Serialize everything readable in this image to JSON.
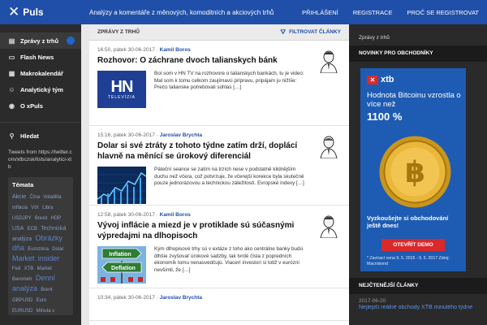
{
  "header": {
    "logo_text": "Puls",
    "tagline": "Analýzy a komentáře z měnových, komoditních a akciových trhů",
    "nav": [
      "PŘIHLÁŠENÍ",
      "REGISTRACE",
      "PROČ SE REGISTROVAT"
    ]
  },
  "sidebar": {
    "items": [
      {
        "label": "Zprávy z trhů",
        "icon": "feed-icon"
      },
      {
        "label": "Flash News",
        "icon": "flash-icon"
      },
      {
        "label": "Makrokalendář",
        "icon": "calendar-icon"
      },
      {
        "label": "Analytický tým",
        "icon": "person-icon"
      },
      {
        "label": "O xPuls",
        "icon": "info-icon"
      }
    ],
    "search_label": "Hledat",
    "tweets_text": "Tweets from https://twitter.com/xtbczsk/lists/analytici-xtb",
    "topics_title": "Témata",
    "topics": [
      {
        "t": "Akcie",
        "s": 2
      },
      {
        "t": "Čína",
        "s": 1
      },
      {
        "t": "Volatilita",
        "s": 1
      },
      {
        "t": "Inflácia",
        "s": 1
      },
      {
        "t": "VIX",
        "s": 1
      },
      {
        "t": "Libra",
        "s": 1
      },
      {
        "t": "USDJPY",
        "s": 1
      },
      {
        "t": "Brexit",
        "s": 1
      },
      {
        "t": "HDP",
        "s": 1
      },
      {
        "t": "USA",
        "s": 2
      },
      {
        "t": "ECB",
        "s": 1
      },
      {
        "t": "Technická",
        "s": 2
      },
      {
        "t": "analýza",
        "s": 2
      },
      {
        "t": "Obrázky",
        "s": 3
      },
      {
        "t": "dňa",
        "s": 3
      },
      {
        "t": "Eurozóna",
        "s": 1
      },
      {
        "t": "Dolar",
        "s": 1
      },
      {
        "t": "Market",
        "s": 3
      },
      {
        "t": "insider",
        "s": 3
      },
      {
        "t": "Fed",
        "s": 1
      },
      {
        "t": "XTB",
        "s": 1
      },
      {
        "t": "Market",
        "s": 1
      },
      {
        "t": "Barometr",
        "s": 1
      },
      {
        "t": "Denní",
        "s": 3
      },
      {
        "t": "analýza",
        "s": 3
      },
      {
        "t": "Brent",
        "s": 1
      },
      {
        "t": "GBPUSD",
        "s": 1
      },
      {
        "t": "Euro",
        "s": 1
      },
      {
        "t": "EURUSD",
        "s": 1
      },
      {
        "t": "Minuta s",
        "s": 1
      },
      {
        "t": "XTB",
        "s": 2
      },
      {
        "t": "Ranní",
        "s": 3
      },
      {
        "t": "komentář",
        "s": 3
      },
      {
        "t": "Měnová",
        "s": 1
      }
    ]
  },
  "main": {
    "section_title": "ZPRÁVY Z TRHŮ",
    "filter_label": "FILTROVAT ČLÁNKY",
    "articles": [
      {
        "time": "16:50, pátek 30-06-2017",
        "author": "Kamil Boros",
        "title": "Rozhovor: O záchrane dvoch talianskych bánk",
        "excerpt": "Boí som v HN TV na rozhovore o talianskych bankách, tu je video: Mal som k tomu celkom zaujímavú prípravu, pripájam ju nižšie: Prečo talianske potrebovali súhlas […]",
        "thumb": {
          "type": "hn",
          "big": "HN",
          "small": "TELEVÍZIA"
        }
      },
      {
        "time": "15:16, pátek 30-06-2017",
        "author": "Jaroslav Brychta",
        "title": "Dolar si své ztráty z tohoto týdne zatím drží, doplácí hlavně na měnící se úrokový diferenciál",
        "excerpt": "Páteční seance se zatím na trzích nese v podstatně klidnějším duchu než včera, což potvrzuje, že včerejší korekce byla skutečně pouze jednorázovou a technickou záležitostí. Evropské indexy […]",
        "thumb": {
          "type": "chart"
        }
      },
      {
        "time": "12:58, pátek 30-06-2017",
        "author": "Kamil Boros",
        "title": "Vývoj inflácie a miezd je v protiklade sú súčasnými výpredajmi na dlhopisoch",
        "excerpt": "Kým dlhopisové trhy sú v extáze z toho ako centrálne banky budú dlhšie zvyšovať úrokové sadzby, tak tvrdé čísla z popredních ekonomík tomu nenasvedčujú. Viacerí investori si totiž v eurózni nevšimli, že […]",
        "thumb": {
          "type": "sign",
          "top": "Inflation",
          "bottom": "Deflation"
        }
      },
      {
        "time": "10:34, pátek 30-06-2017",
        "author": "Jaroslav Brychta",
        "title": "",
        "excerpt": "",
        "thumb": {
          "type": "none"
        }
      }
    ]
  },
  "right": {
    "crumb": "Zprávy z trhů",
    "section_news": "NOVINKY PRO OBCHODNÍKY",
    "ad": {
      "logo": "xtb",
      "headline": "Hodnota Bitcoinu vzrostla o více než",
      "big": "1100 %",
      "cta": "Vyzkoušejte si obchodování ještě dnes!",
      "button": "OTEVŘÍT DEMO",
      "note": "* Zavírací cena 9. 5. 2015 - 9. 5. 2017 Zdroj: Macrobond"
    },
    "section_latest": "NEJČTENĚJŠÍ ČLÁNKY",
    "latest": [
      {
        "date": "2017-06-20",
        "link": "Nejlepší reálné obchody XTB minulého týdne"
      }
    ]
  }
}
